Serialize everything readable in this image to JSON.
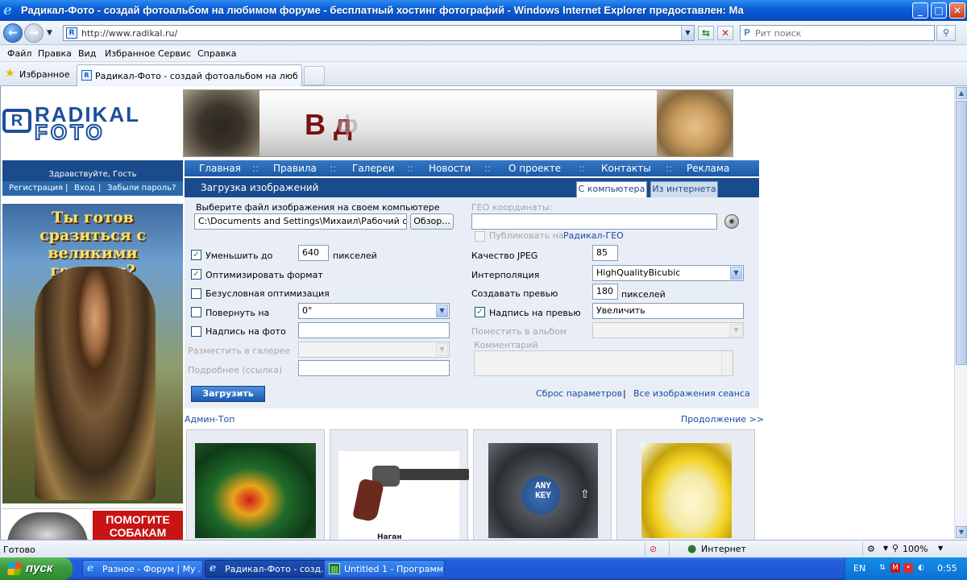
{
  "window": {
    "title": "Радикал-Фото - создай фотоальбом на любимом форуме - бесплатный хостинг фотографий - Windows Internet Explorer предоставлен: Ма",
    "minimize": "_",
    "maximize": "□",
    "close": "✕"
  },
  "address": {
    "url": "http://www.radikal.ru/",
    "search_placeholder": "Рит поиск"
  },
  "menu": [
    "Файл",
    "Правка",
    "Вид",
    "Избранное",
    "Сервис",
    "Справка"
  ],
  "favorites": {
    "label": "Избранное"
  },
  "tab": {
    "label": "Радикал-Фото - создай фотоальбом на любимом ф..."
  },
  "site": {
    "logo_top": "RADIKAL",
    "logo_bottom": "FOTO",
    "logo_mark": "R",
    "banner_text": "В д",
    "banner_text2": "ф",
    "welcome": "Здравствуйте, Гость",
    "auth": {
      "register": "Регистрация",
      "login": "Вход",
      "forgot": "Забыли пароль?",
      "sep": "|"
    },
    "promo_headline": "Ты готов сразиться с великими героями?",
    "promo2_text": "ПОМОГИТЕ СОБАКАМ",
    "nav": [
      "Главная",
      "Правила",
      "Галереи",
      "Новости",
      "О проекте",
      "Контакты",
      "Реклама"
    ],
    "nav_sep": "::",
    "upload_title": "Загрузка изображений",
    "tab_computer": "С компьютера",
    "tab_internet": "Из интернета"
  },
  "form": {
    "choose_file_label": "Выберите файл изображения на своем компьютере",
    "file_path": "C:\\Documents and Settings\\Михаил\\Рабочий ст",
    "browse": "Обзор...",
    "geo_label": "ГЕО координаты:",
    "publish_geo_prefix": "Публиковать на",
    "publish_geo_link": "Радикал-ГЕО",
    "reduce_label": "Уменьшить до",
    "reduce_value": "640",
    "pixels": "пикселей",
    "jpeg_label": "Качество JPEG",
    "jpeg_value": "85",
    "optimize_label": "Оптимизировать формат",
    "interp_label": "Интерполяция",
    "interp_value": "HighQualityBicubic",
    "uncond_label": "Безусловная оптимизация",
    "preview_label": "Создавать превью",
    "preview_value": "180",
    "rotate_label": "Повернуть на",
    "rotate_value": "0°",
    "preview_caption_label": "Надпись на превью",
    "preview_caption_value": "Увеличить",
    "photo_caption_label": "Надпись на фото",
    "album_label": "Поместить в альбом",
    "gallery_label": "Разместить в галерее",
    "comment_label": "Комментарий",
    "details_label": "Подробнее (ссылка)",
    "submit": "Загрузить",
    "reset_link": "Сброс параметров",
    "session_link": "Все изображения сеанса",
    "link_sep": "|",
    "check": "✓"
  },
  "admintop": {
    "title": "Админ-Топ",
    "more": "Продолжение >>",
    "gun_caption": "Наган",
    "anykey": "ANY KEY"
  },
  "status": {
    "ready": "Готово",
    "zone": "Интернет",
    "zoom": "100%"
  },
  "taskbar": {
    "start": "пуск",
    "tasks": [
      "Разное - Форум | Му ...",
      "Радикал-Фото - созд...",
      "Untitled 1 - Программ..."
    ],
    "lang": "EN",
    "clock": "0:55"
  },
  "colors": {
    "site_blue": "#1a4b8c",
    "nav_blue": "#2567b6",
    "link_blue": "#1a4ba8",
    "form_bg": "#e9eef6"
  }
}
